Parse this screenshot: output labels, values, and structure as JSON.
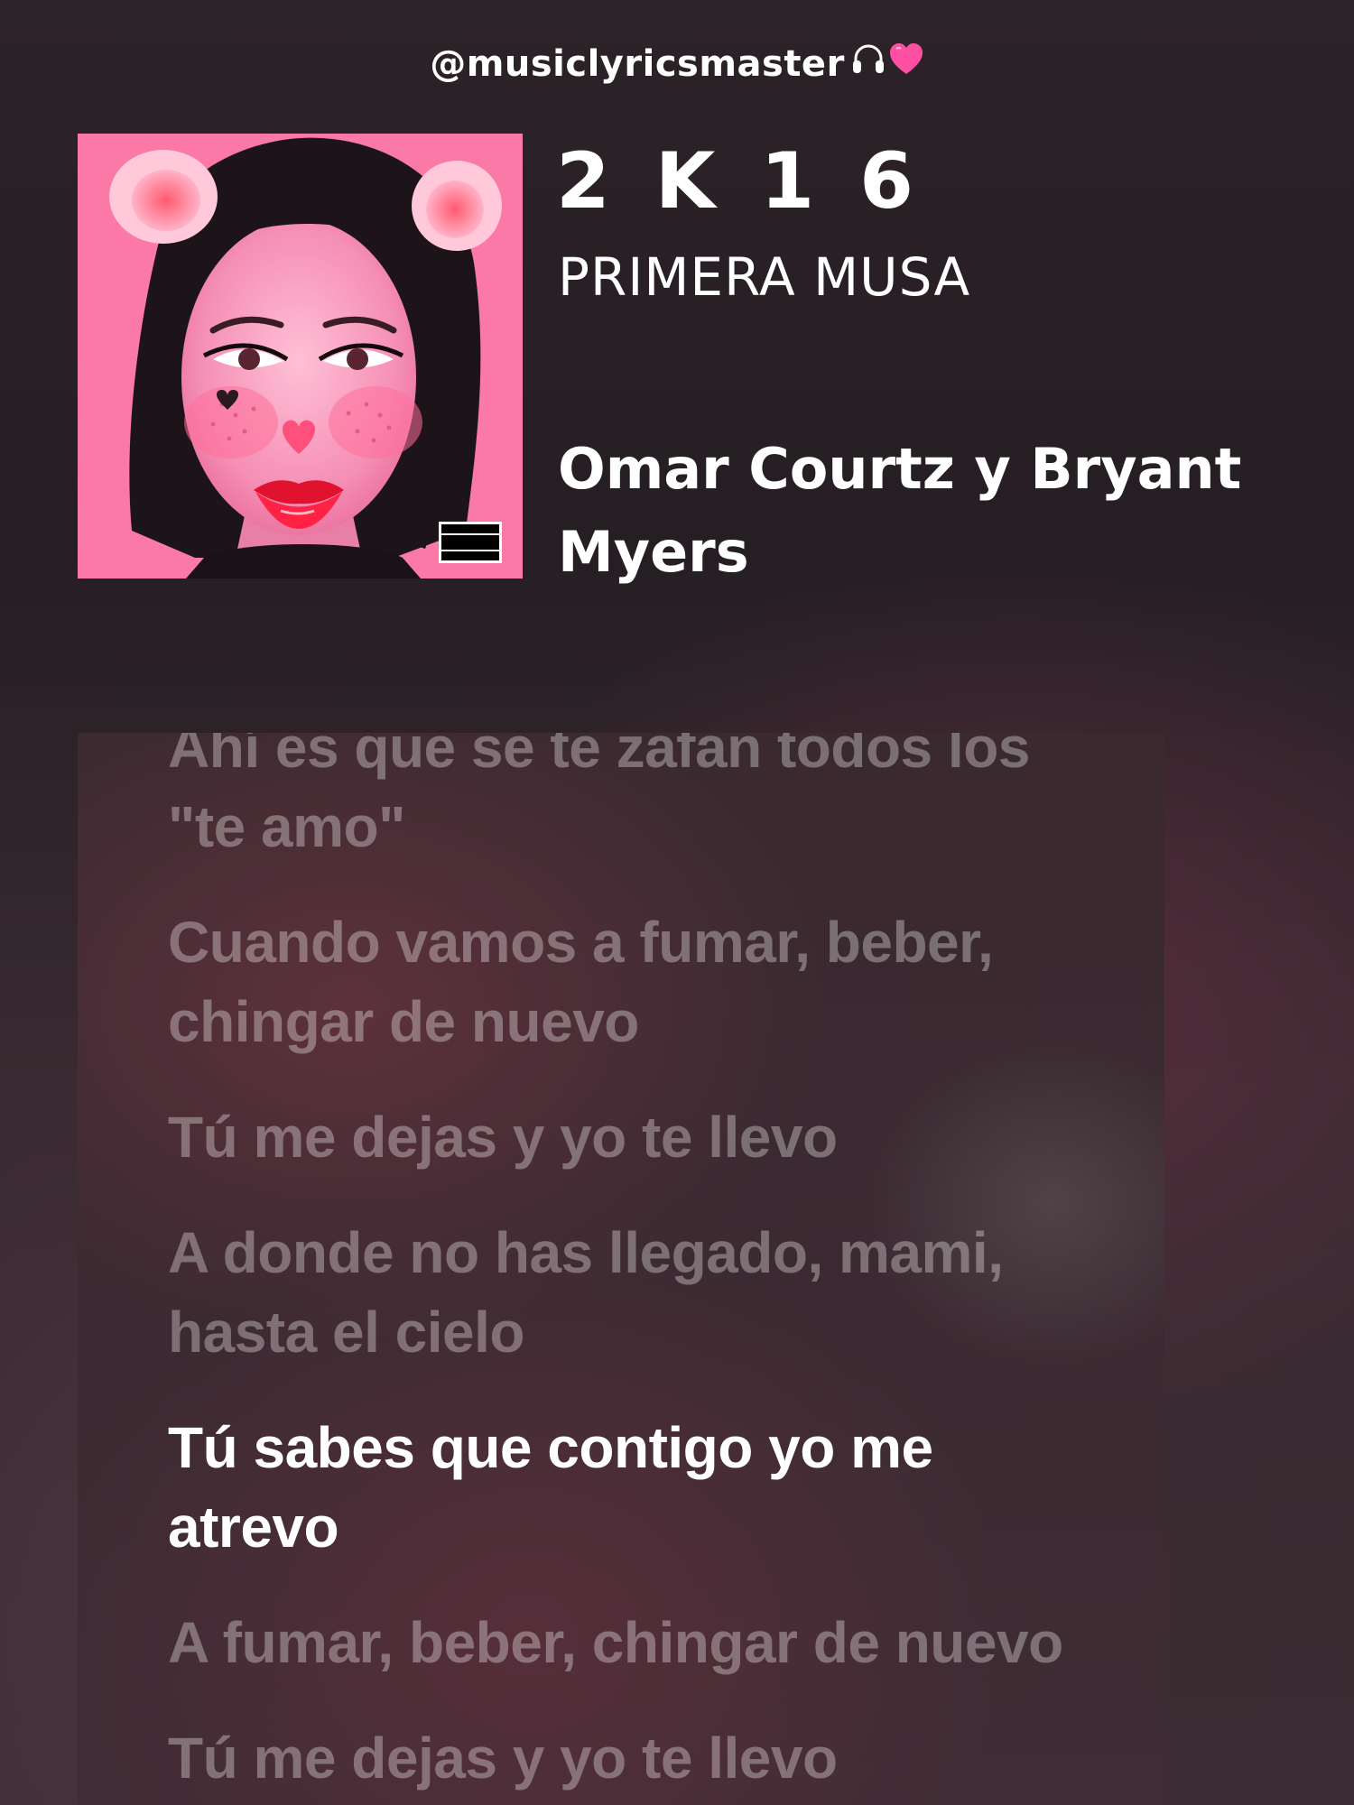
{
  "watermark": {
    "handle": "@musiclyricsmaster",
    "icons": [
      "headphones-icon",
      "pink-heart-icon"
    ]
  },
  "track": {
    "title": "2 K 1 6",
    "album": "PRIMERA MUSA",
    "artists_line1": "Omar Courtz y Bryant",
    "artists_line2": "Myers"
  },
  "album_art": {
    "advisory_line1": "PARENTAL",
    "advisory_line2": "ADVISORY",
    "advisory_line3": "EXPLICIT CONTENT"
  },
  "lyrics": [
    {
      "text": "Ahí es que se te zafan todos los \"te amo\"",
      "state": "past"
    },
    {
      "text": "Cuando vamos a fumar, beber, chingar de nuevo",
      "state": "past"
    },
    {
      "text": "Tú me dejas y yo te llevo",
      "state": "past"
    },
    {
      "text": "A donde no has llegado, mami, hasta el cielo",
      "state": "past"
    },
    {
      "text": "Tú sabes que contigo yo me atrevo",
      "state": "current"
    },
    {
      "text": "A fumar, beber, chingar de nuevo",
      "state": "upcoming"
    },
    {
      "text": "Tú me dejas y yo te llevo",
      "state": "upcoming"
    }
  ],
  "colors": {
    "accent_pink": "#f45e92",
    "heart": "#ff4fa3",
    "active_lyric": "#ffffff",
    "inactive_lyric": "rgba(255,255,255,0.33)"
  }
}
